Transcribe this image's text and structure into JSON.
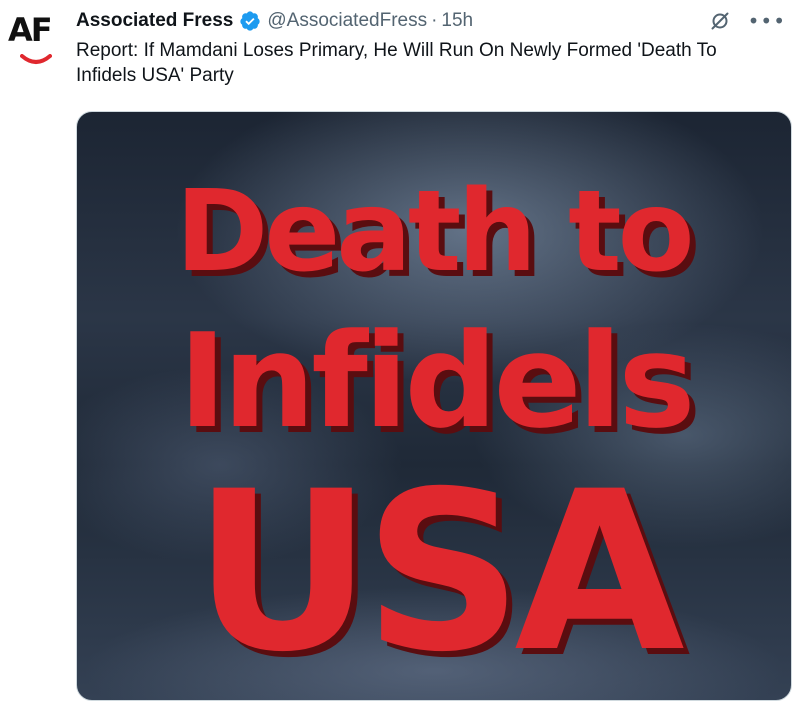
{
  "account": {
    "avatar_text": "AF",
    "display_name": "Associated Fress",
    "handle": "@AssociatedFress",
    "separator": "·",
    "time": "15h"
  },
  "tweet": {
    "text": "Report: If Mamdani Loses Primary, He Will Run On Newly Formed 'Death To Infidels USA' Party"
  },
  "media": {
    "line1": "Death to",
    "line2": "Infidels",
    "line3": "USA"
  },
  "colors": {
    "verified": "#1d9bf0",
    "headline_red": "#e0282e",
    "logo_smile": "#e0282e",
    "secondary_text": "#536471"
  },
  "icons": {
    "verified": "verified-badge-icon",
    "grok": "grok-icon",
    "more": "more-icon"
  }
}
